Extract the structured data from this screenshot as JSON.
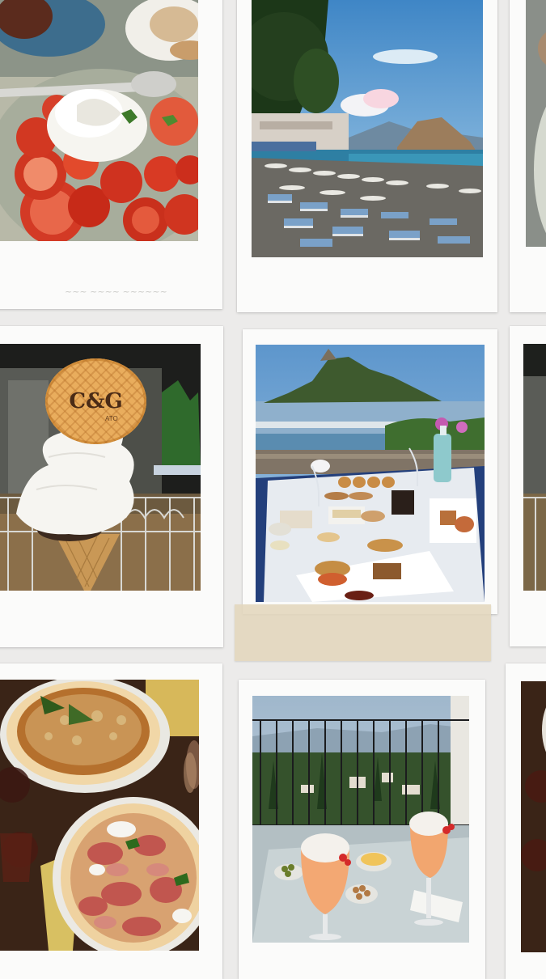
{
  "collage": {
    "background": "#ecebea",
    "paper": "#fbfbfa",
    "tape_color": "#e2d6bc",
    "photos": [
      {
        "id": "caprese",
        "subject": "burrata with sliced tomatoes and basil"
      },
      {
        "id": "beach",
        "subject": "beach club with sun loungers and parasols by the sea"
      },
      {
        "id": "gelato",
        "subject": "gelato cone with waffle wafer at night"
      },
      {
        "id": "lunch",
        "subject": "terrace lunch table overlooking an island"
      },
      {
        "id": "pizza",
        "subject": "two pizzas with prosciutto and wine glasses"
      },
      {
        "id": "spritz",
        "subject": "spritz cocktails on a balcony with hillside view"
      }
    ]
  },
  "gelato_wafer": {
    "brand": "C&G",
    "small_text": "ATO"
  }
}
